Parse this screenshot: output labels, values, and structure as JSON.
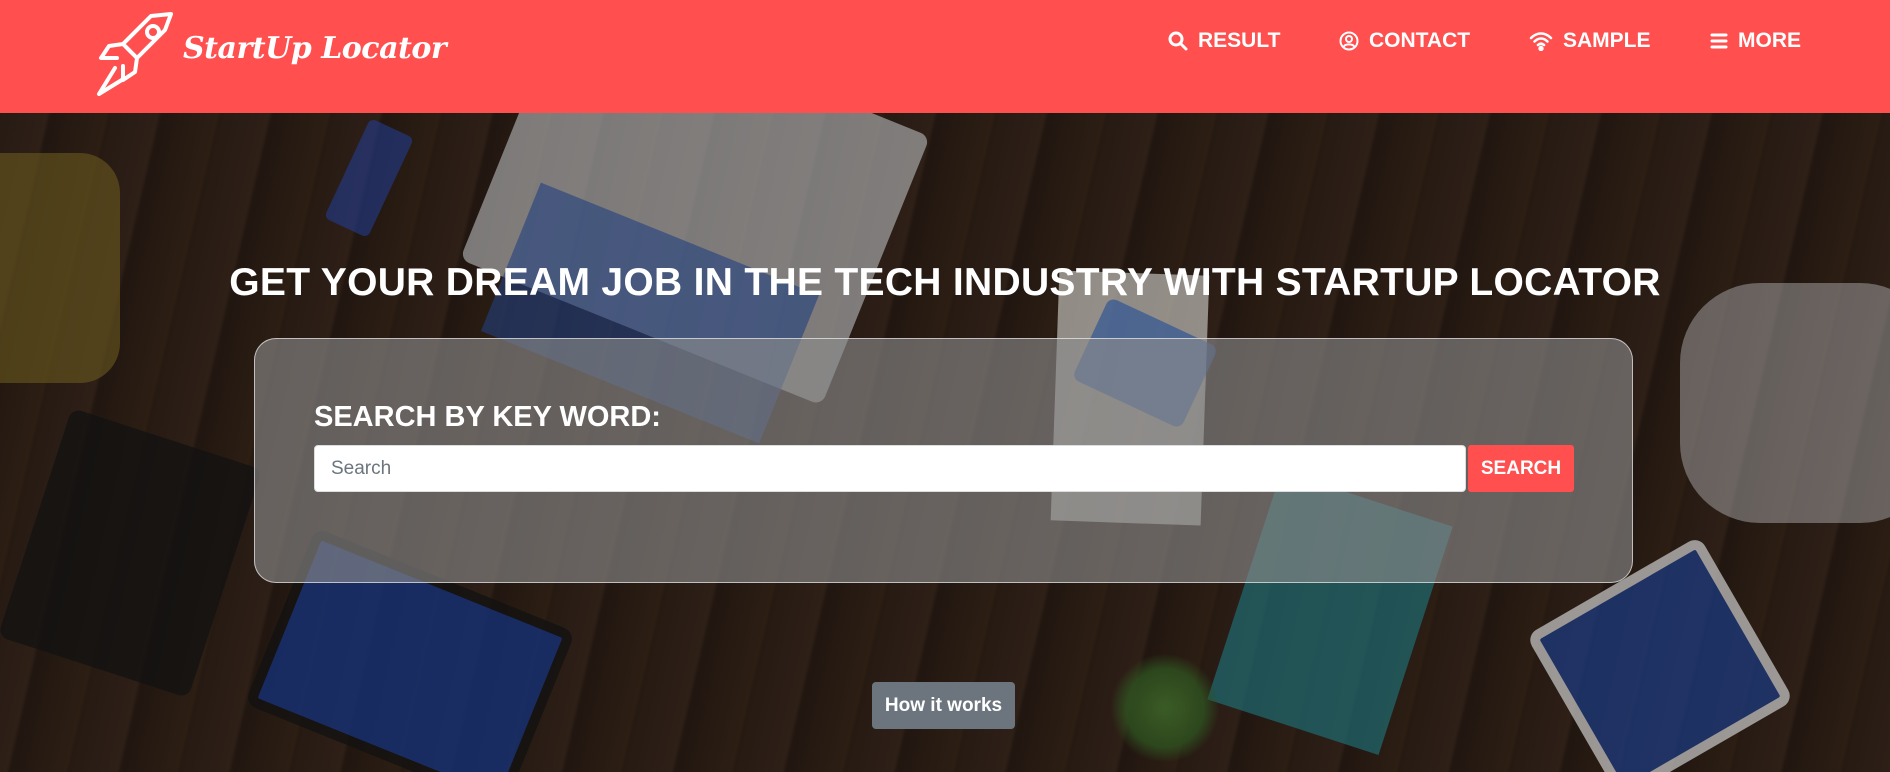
{
  "brand": {
    "logo_icon": "rocket-icon",
    "name": "StartUp Locator"
  },
  "nav": {
    "items": [
      {
        "label": "RESULT",
        "icon": "search-icon"
      },
      {
        "label": "CONTACT",
        "icon": "user-circle-icon"
      },
      {
        "label": "SAMPLE",
        "icon": "wifi-icon"
      },
      {
        "label": "MORE",
        "icon": "menu-icon"
      }
    ]
  },
  "hero": {
    "title": "GET YOUR DREAM JOB IN THE TECH INDUSTRY WITH STARTUP LOCATOR",
    "background": "photo-team-working-with-laptops-and-tablets",
    "search": {
      "label": "SEARCH BY KEY WORD:",
      "placeholder": "Search",
      "value": "",
      "button_label": "SEARCH"
    },
    "how_it_works_label": "How it works"
  },
  "colors": {
    "brand": "#ff4f4f",
    "secondary_button": "#6c757d",
    "text_light": "#ffffff"
  }
}
